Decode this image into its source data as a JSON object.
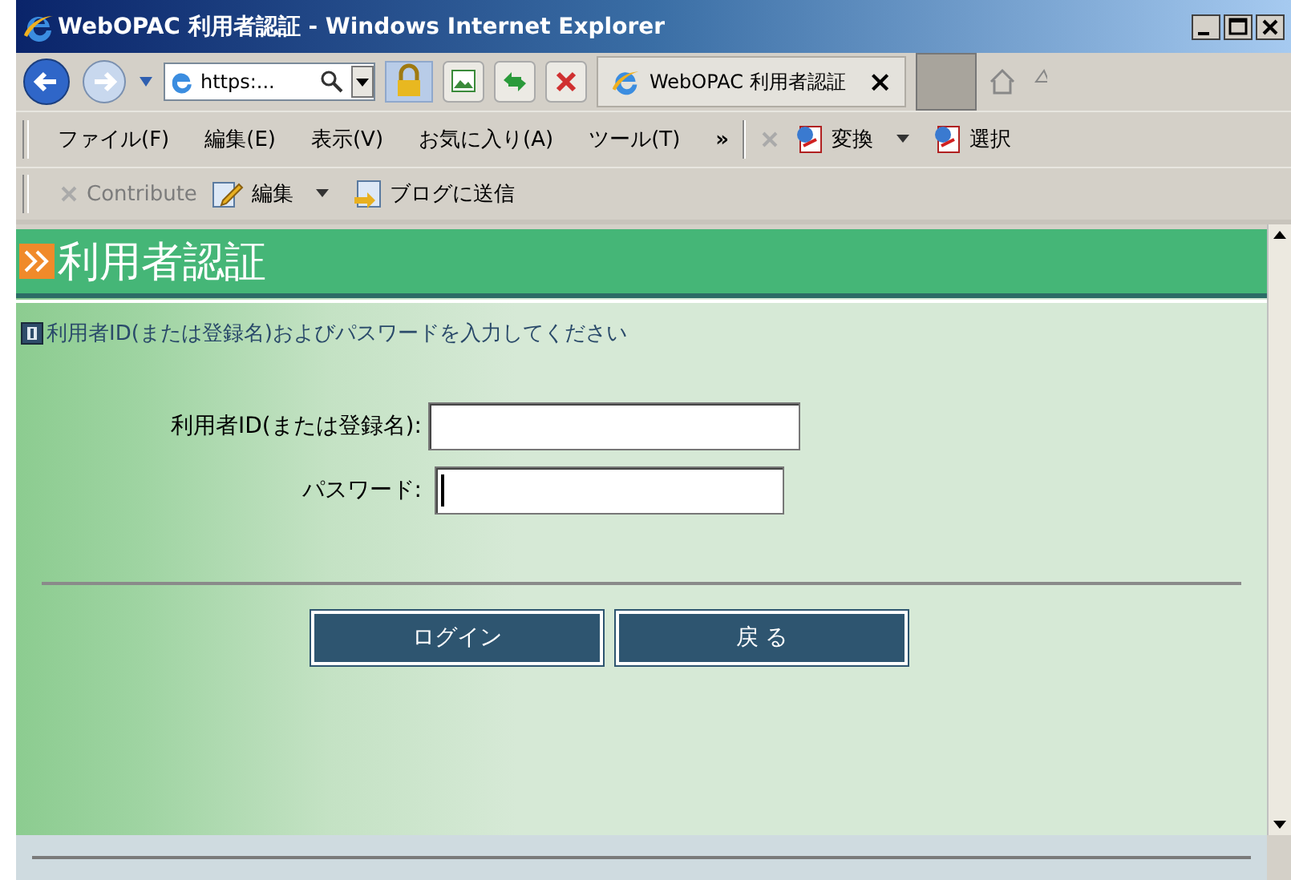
{
  "window": {
    "title": "WebOPAC 利用者認証 - Windows Internet Explorer"
  },
  "nav": {
    "address": "https:...",
    "tab_title": "WebOPAC 利用者認証",
    "tab_close": "×"
  },
  "menu": {
    "items": [
      "ファイル(F)",
      "編集(E)",
      "表示(V)",
      "お気に入り(A)",
      "ツール(T)"
    ],
    "more": "»",
    "tools": [
      {
        "label": "変換",
        "dropdown": true
      },
      {
        "label": "選択",
        "dropdown": false
      }
    ]
  },
  "toolbar": {
    "items": [
      {
        "label": "Contribute",
        "kind": "contribute",
        "disabled": true,
        "dropdown": false
      },
      {
        "label": "編集",
        "kind": "edit",
        "disabled": false,
        "dropdown": true
      },
      {
        "label": "ブログに送信",
        "kind": "blog",
        "disabled": false,
        "dropdown": false
      }
    ]
  },
  "page": {
    "heading": "利用者認証",
    "info": "利用者ID(または登録名)およびパスワードを入力してください",
    "fields": [
      {
        "label": "利用者ID(または登録名):",
        "focused": false
      },
      {
        "label": "パスワード:",
        "focused": true
      }
    ],
    "buttons": [
      "ログイン",
      "戻 る"
    ]
  }
}
